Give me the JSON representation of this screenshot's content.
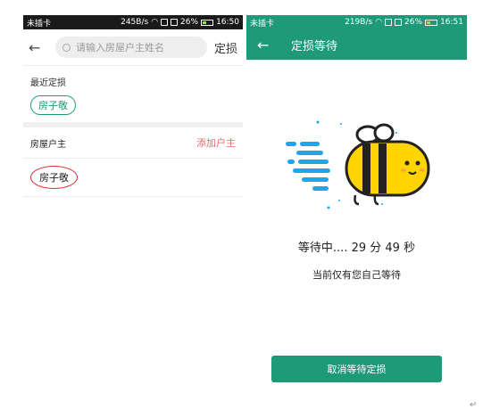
{
  "left": {
    "status": {
      "carrier": "未插卡",
      "speed": "245B/s",
      "battery": "26%",
      "time": "16:50"
    },
    "search": {
      "placeholder": "请输入房屋户主姓名",
      "action": "定损"
    },
    "recent_label": "最近定损",
    "recent_items": [
      "房子敬"
    ],
    "owner_label": "房屋户主",
    "add_owner": "添加户主",
    "owners": [
      "房子敬"
    ]
  },
  "right": {
    "status": {
      "carrier": "未插卡",
      "speed": "219B/s",
      "battery": "26%",
      "time": "16:51"
    },
    "title": "定损等待",
    "waiting": "等待中.... 29 分 49 秒",
    "queue_note": "当前仅有您自己等待",
    "cancel_button": "取消等待定损"
  },
  "colors": {
    "accent": "#1e9a79",
    "add_owner": "#e36a6a",
    "highlight_circle": "#d92b2b",
    "bee_yellow": "#ffd400",
    "speed_lines": "#1ea5ef"
  },
  "icons": [
    "back-arrow-icon",
    "search-icon",
    "bee-illustration",
    "wifi-icon",
    "battery-icon"
  ],
  "corner_mark": "↵"
}
